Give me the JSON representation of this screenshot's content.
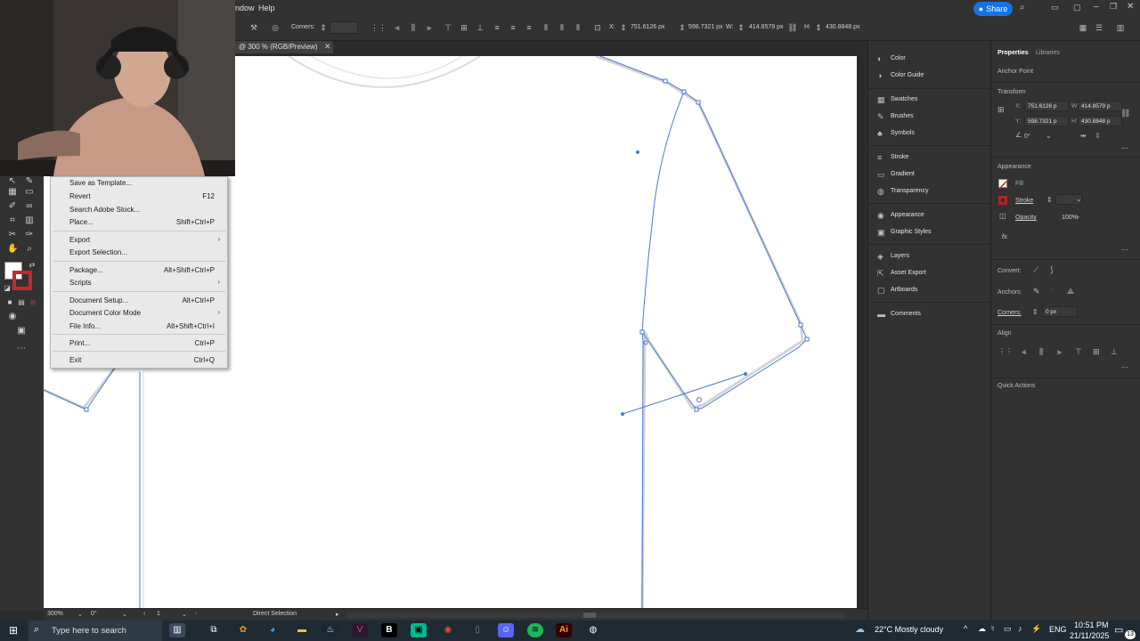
{
  "menubar": {
    "items": [
      "ndow",
      "Help"
    ],
    "share_label": "Share"
  },
  "control_bar": {
    "corners_label": "Corners:",
    "x_label": "X:",
    "x_value": "751.6126 px",
    "y_value": "598.7321 px",
    "w_label": "W:",
    "w_value": "414.8579 px",
    "h_label": "H:",
    "h_value": "430.8848 px"
  },
  "document_tab": {
    "title": "@ 300 % (RGB/Preview)",
    "close": "✕"
  },
  "file_menu": {
    "items": [
      {
        "label": "Save as Template...",
        "shortcut": "",
        "submenu": false
      },
      {
        "label": "Revert",
        "shortcut": "F12",
        "submenu": false
      },
      {
        "label": "Search Adobe Stock...",
        "shortcut": "",
        "submenu": false
      },
      {
        "label": "Place...",
        "shortcut": "Shift+Ctrl+P",
        "submenu": false
      },
      {
        "label": "Export",
        "shortcut": "",
        "submenu": true
      },
      {
        "label": "Export Selection...",
        "shortcut": "",
        "submenu": false
      },
      {
        "label": "Package...",
        "shortcut": "Alt+Shift+Ctrl+P",
        "submenu": false
      },
      {
        "label": "Scripts",
        "shortcut": "",
        "submenu": true
      },
      {
        "label": "Document Setup...",
        "shortcut": "Alt+Ctrl+P",
        "submenu": false
      },
      {
        "label": "Document Color Mode",
        "shortcut": "",
        "submenu": true
      },
      {
        "label": "File Info...",
        "shortcut": "Alt+Shift+Ctrl+I",
        "submenu": false
      },
      {
        "label": "Print...",
        "shortcut": "Ctrl+P",
        "submenu": false
      },
      {
        "label": "Exit",
        "shortcut": "Ctrl+Q",
        "submenu": false
      }
    ]
  },
  "status_bar": {
    "zoom": "300%",
    "rotation": "0°",
    "artboard": "1",
    "tool": "Direct Selection"
  },
  "panels": {
    "items": [
      "Color",
      "Color Guide",
      "Swatches",
      "Brushes",
      "Symbols",
      "Stroke",
      "Gradient",
      "Transparency",
      "Appearance",
      "Graphic Styles",
      "Layers",
      "Asset Export",
      "Artboards",
      "Comments"
    ]
  },
  "properties": {
    "tab_properties": "Properties",
    "tab_libraries": "Libraries",
    "selection_type": "Anchor Point",
    "transform_title": "Transform",
    "x_label": "X:",
    "x_value": "751.6126 p",
    "y_label": "Y:",
    "y_value": "598.7321 p",
    "w_label": "W:",
    "w_value": "414.8579 p",
    "h_label": "H:",
    "h_value": "430.8848 p",
    "angle_value": "0°",
    "appearance_title": "Appearance",
    "fill_label": "Fill",
    "stroke_label": "Stroke",
    "opacity_label": "Opacity",
    "opacity_value": "100%",
    "fx_label": "fx.",
    "convert_label": "Convert:",
    "anchors_label": "Anchors:",
    "corners_label": "Corners:",
    "corners_value": "0 px",
    "align_title": "Align",
    "quick_actions_title": "Quick Actions"
  },
  "taskbar": {
    "search_placeholder": "Type here to search",
    "weather": "22°C  Mostly cloudy",
    "language": "ENG",
    "time": "10:51 PM",
    "date": "21/11/2025",
    "notification_count": "13"
  }
}
